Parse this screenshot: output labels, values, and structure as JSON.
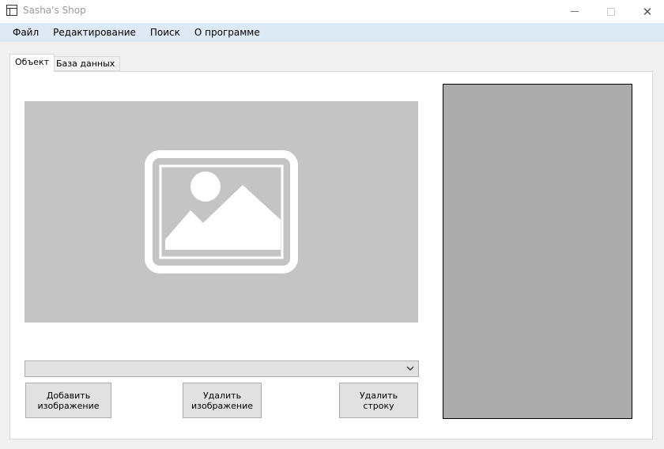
{
  "window": {
    "title": "Sasha's Shop",
    "icons": {
      "app": "window-app-icon",
      "minimize": "minimize-icon",
      "maximize": "maximize-icon",
      "close": "close-icon"
    },
    "close_glyph": "✕"
  },
  "menu": {
    "items": [
      {
        "label": "Файл"
      },
      {
        "label": "Редактирование"
      },
      {
        "label": "Поиск"
      },
      {
        "label": "О программе"
      }
    ]
  },
  "tabs": [
    {
      "label": "Объект",
      "selected": true
    },
    {
      "label": "База данных",
      "selected": false
    }
  ],
  "object_tab": {
    "image_placeholder_icon": "image-placeholder-icon",
    "combo": {
      "value": "",
      "icon": "chevron-down-icon"
    },
    "buttons": {
      "add_image_line1": "Добавить",
      "add_image_line2": "изображение",
      "delete_image_line1": "Удалить",
      "delete_image_line2": "изображение",
      "delete_row": "Удалить строку"
    }
  },
  "colors": {
    "menubar": "#dde9f5",
    "image_placeholder": "#c4c4c4",
    "side_panel": "#ababab",
    "button": "#e1e1e1"
  }
}
